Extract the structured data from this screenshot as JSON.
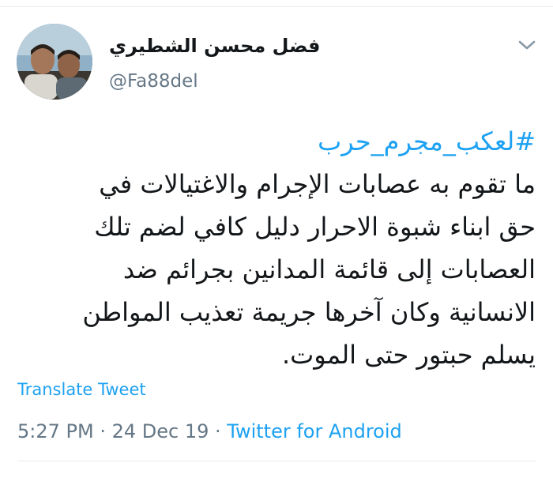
{
  "author": {
    "display_name": "فضل محسن الشطيري",
    "handle": "@Fa88del"
  },
  "icons": {
    "menu": "chevron-down-icon",
    "avatar": "profile-photo"
  },
  "tweet": {
    "hashtag": "#لعكب_مجرم_حرب",
    "lines": [
      "ما تقوم به عصابات الإجرام والاغتيالات في",
      "حق ابناء شبوة الاحرار دليل كافي لضم تلك",
      "العصابات إلى قائمة المدانين بجرائم ضد",
      "الانسانية وكان آخرها جريمة تعذيب المواطن",
      "يسلم حبتور حتى الموت."
    ]
  },
  "translate_label": "Translate Tweet",
  "meta": {
    "time": "5:27 PM",
    "separator": " · ",
    "date": "24 Dec 19",
    "source": "Twitter for Android"
  },
  "colors": {
    "link": "#1da1f2",
    "secondary": "#657786",
    "text": "#14171a",
    "divider": "#e6ecf0"
  }
}
